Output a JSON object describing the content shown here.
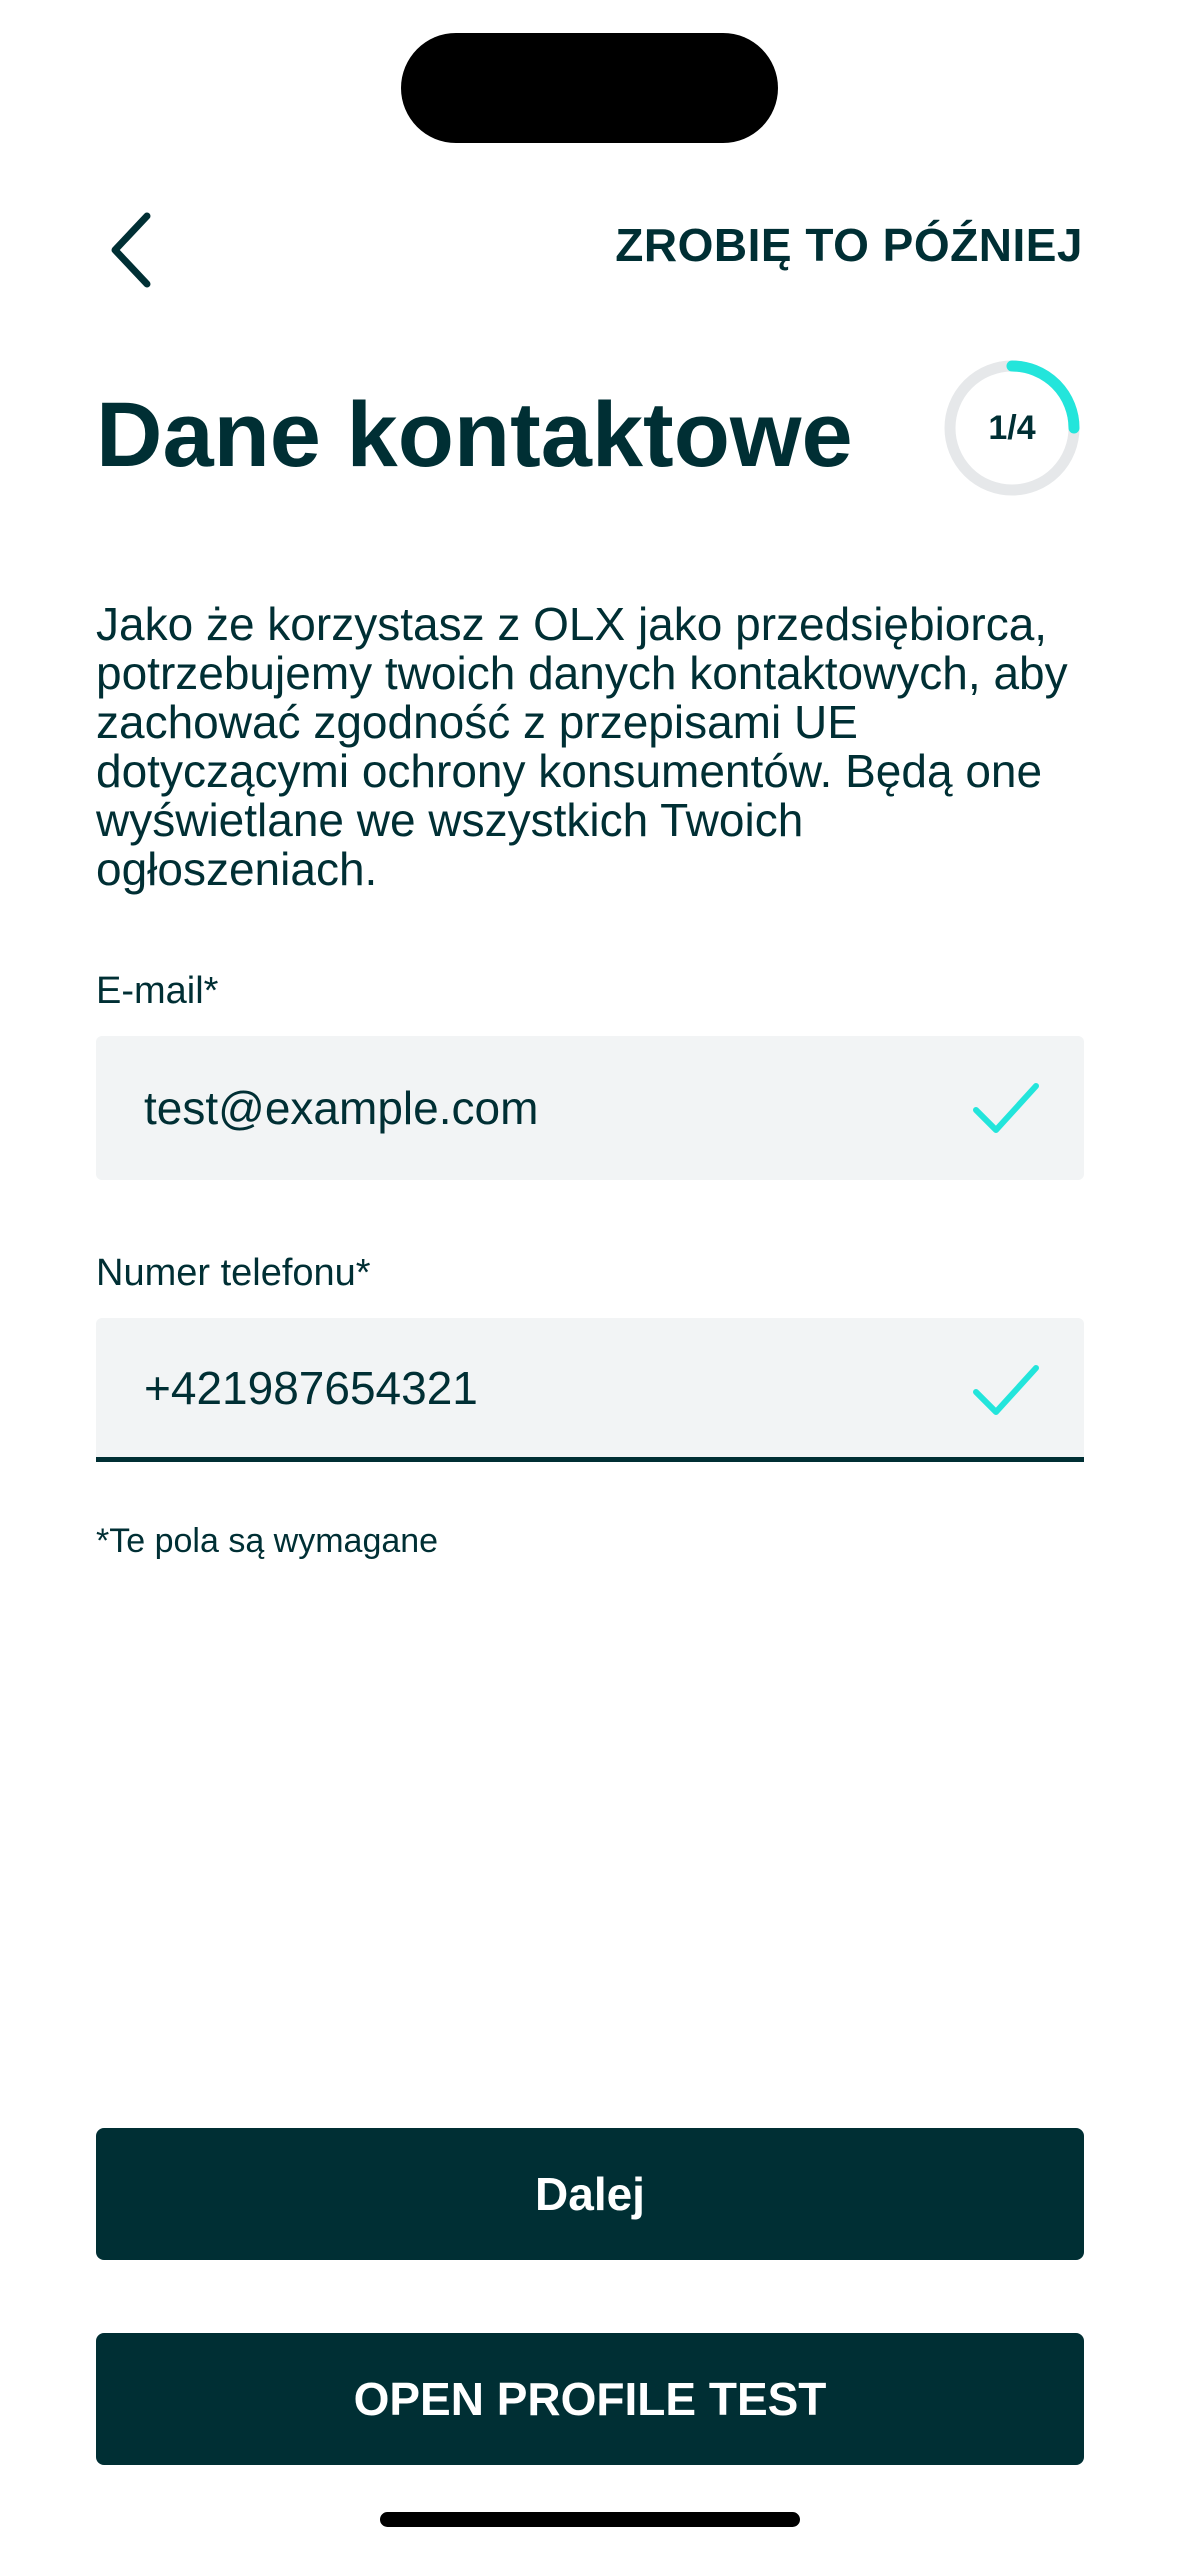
{
  "header": {
    "back_icon": "chevron-left-icon",
    "skip_label": "ZROBIĘ TO PÓŹNIEJ"
  },
  "title": "Dane kontaktowe",
  "progress": {
    "label": "1/4",
    "value": 0.25,
    "color": "#23e5db",
    "track_color": "#e6e8ea"
  },
  "description": "Jako że korzystasz z OLX jako przedsiębiorca, potrzebujemy twoich danych kontaktowych, aby zachować zgodność z przepisami UE dotyczącymi ochrony konsumentów. Będą one wyświetlane we wszystkich Twoich ogłoszeniach.",
  "form": {
    "email": {
      "label": "E-mail*",
      "value": "test@example.com",
      "status_icon": "checkmark-icon"
    },
    "phone": {
      "label": "Numer telefonu*",
      "value": "+421987654321",
      "status_icon": "checkmark-icon"
    },
    "required_note": "*Te pola są wymagane"
  },
  "buttons": {
    "next_label": "Dalej",
    "profile_test_label": "OPEN PROFILE TEST"
  },
  "colors": {
    "primary": "#002f34",
    "accent": "#23e5db",
    "field_bg": "#f2f4f5"
  }
}
